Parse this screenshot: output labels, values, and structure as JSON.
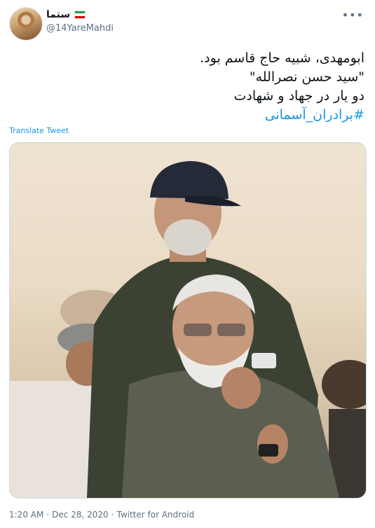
{
  "author": {
    "display_name": "ستما",
    "handle": "@14YareMahdi",
    "flag_colors": [
      "#239f40",
      "#ffffff",
      "#da0000"
    ]
  },
  "tweet": {
    "lines": [
      "ابومهدی، شبیه حاج قاسم بود.",
      "\"سید حسن نصرالله\"",
      "دو یار در جهاد و شهادت"
    ],
    "hashtag": "#برادران_آسمانی"
  },
  "translate_label": "Translate Tweet",
  "meta": {
    "time": "1:20 AM",
    "separator": "·",
    "date": "Dec 28, 2020",
    "source": "Twitter for Android"
  },
  "icons": {
    "more": "more-options-icon"
  },
  "colors": {
    "link": "#1b95e0",
    "secondary_text": "#5b7083"
  }
}
